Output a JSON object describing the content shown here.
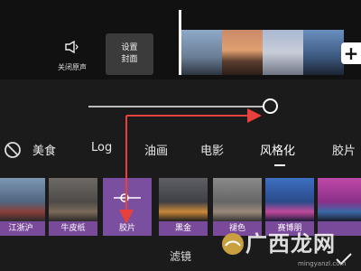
{
  "toolbar": {
    "mute_label": "关闭原声",
    "cover_label_line1": "设置",
    "cover_label_line2": "封面",
    "add_symbol": "+"
  },
  "filter_panel": {
    "slider_value": 1.0,
    "categories": [
      "美食",
      "Log",
      "油画",
      "电影",
      "风格化",
      "胶片"
    ],
    "active_category": "风格化",
    "filters": [
      "江浙沪",
      "牛皮纸",
      "胶片",
      "黑金",
      "褪色",
      "赛博朋"
    ],
    "selected_filter": "胶片",
    "title": "滤镜"
  },
  "watermark": {
    "text": "广西龙网",
    "url": "mingyanzl.com"
  },
  "colors": {
    "accent_purple": "#7a4fa0",
    "arrow_red": "#e8403a"
  }
}
